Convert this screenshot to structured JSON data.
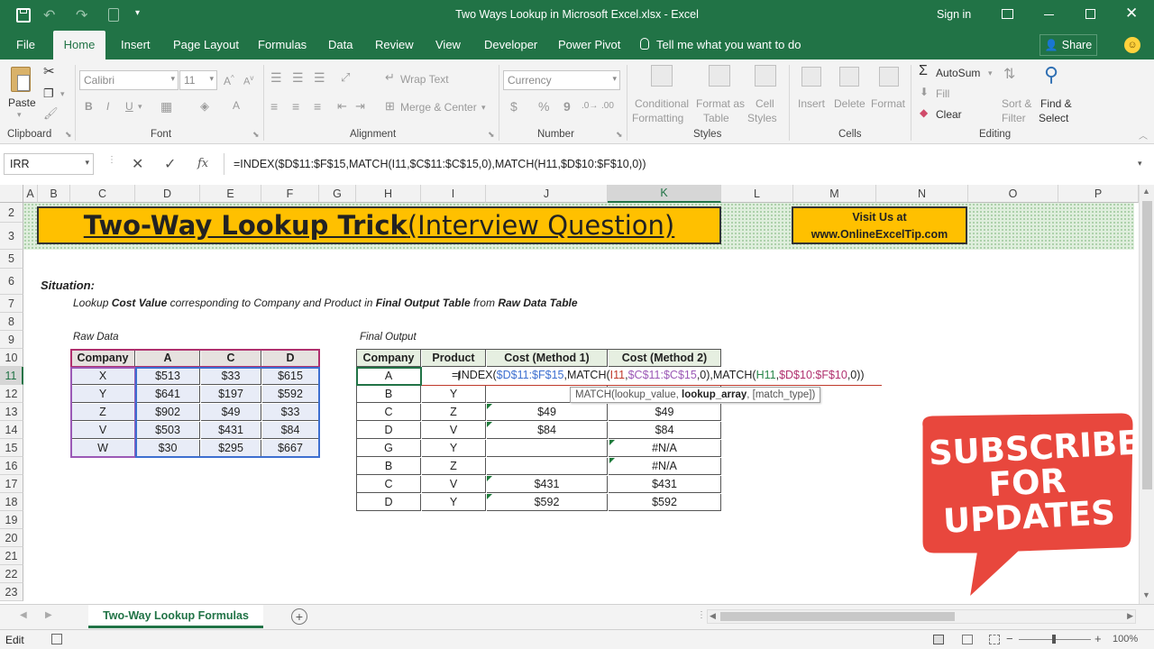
{
  "window": {
    "title": "Two Ways Lookup in Microsoft Excel.xlsx  -  Excel",
    "sign_in": "Sign in"
  },
  "tabs": [
    "File",
    "Home",
    "Insert",
    "Page Layout",
    "Formulas",
    "Data",
    "Review",
    "View",
    "Developer",
    "Power Pivot"
  ],
  "tell_me": "Tell me what you want to do",
  "share": "Share",
  "ribbon": {
    "clipboard": {
      "paste": "Paste",
      "label": "Clipboard"
    },
    "font": {
      "name": "Calibri",
      "size": "11",
      "label": "Font",
      "bold": "B",
      "italic": "I",
      "underline": "U"
    },
    "alignment": {
      "wrap": "Wrap Text",
      "merge": "Merge & Center",
      "label": "Alignment"
    },
    "number": {
      "format": "Currency",
      "currency": "$",
      "percent": "%",
      "comma": "9",
      "label": "Number"
    },
    "styles": {
      "conditional": "Conditional",
      "formatting": "Formatting",
      "format_as": "Format as",
      "table": "Table",
      "cell": "Cell",
      "cell_styles": "Styles",
      "label": "Styles"
    },
    "cells": {
      "insert": "Insert",
      "delete": "Delete",
      "format": "Format",
      "label": "Cells"
    },
    "editing": {
      "autosum": "AutoSum",
      "fill": "Fill",
      "clear": "Clear",
      "sort": "Sort &",
      "filter": "Filter",
      "find": "Find &",
      "select": "Select",
      "label": "Editing"
    }
  },
  "formula_bar": {
    "name_box": "IRR",
    "fx": "fx",
    "formula": "=INDEX($D$11:$F$15,MATCH(I11,$C$11:$C$15,0),MATCH(H11,$D$10:$F$10,0))"
  },
  "columns": [
    "A",
    "B",
    "C",
    "D",
    "E",
    "F",
    "G",
    "H",
    "I",
    "J",
    "K",
    "L",
    "M",
    "N",
    "O",
    "P"
  ],
  "rows": [
    "2",
    "3",
    "5",
    "6",
    "7",
    "8",
    "9",
    "10",
    "11",
    "12",
    "13",
    "14",
    "15",
    "16",
    "17",
    "18",
    "19",
    "20",
    "21",
    "22",
    "23"
  ],
  "sheet": {
    "title_bold": "Two-Way Lookup Trick",
    "title_rest": " (Interview Question)",
    "visit_line1": "Visit Us at",
    "visit_line2": "www.OnlineExcelTip.com",
    "situation": "Situation:",
    "desc": [
      "Lookup ",
      "Cost Value",
      " corresponding to Company and Product in ",
      "Final Output Table",
      " from ",
      "Raw Data Table"
    ],
    "raw_caption": "Raw Data",
    "out_caption": "Final Output",
    "raw_headers": [
      "Company",
      "A",
      "C",
      "D"
    ],
    "raw_rows": [
      [
        "X",
        "$513",
        "$33",
        "$615"
      ],
      [
        "Y",
        "$641",
        "$197",
        "$592"
      ],
      [
        "Z",
        "$902",
        "$49",
        "$33"
      ],
      [
        "V",
        "$503",
        "$431",
        "$84"
      ],
      [
        "W",
        "$30",
        "$295",
        "$667"
      ]
    ],
    "out_headers": [
      "Company",
      "Product",
      "Cost (Method 1)",
      "Cost (Method 2)"
    ],
    "out_rows": [
      [
        "A",
        "",
        "",
        ""
      ],
      [
        "B",
        "Y",
        "",
        ""
      ],
      [
        "C",
        "Z",
        "$49",
        "$49"
      ],
      [
        "D",
        "V",
        "$84",
        "$84"
      ],
      [
        "G",
        "Y",
        "",
        "#N/A"
      ],
      [
        "B",
        "Z",
        "",
        "#N/A"
      ],
      [
        "C",
        "V",
        "$431",
        "$431"
      ],
      [
        "D",
        "Y",
        "$592",
        "$592"
      ]
    ],
    "editing_formula": [
      "=INDEX(",
      "$D$11:$F$15",
      ",MATCH(",
      "I11",
      ",",
      "$C$11:$C$15",
      ",0),MATCH(",
      "H11",
      ",",
      "$D$10:$F$10",
      ",0))"
    ],
    "tooltip": [
      "MATCH(lookup_value, ",
      "lookup_array",
      ", [match_type])"
    ]
  },
  "subscribe": [
    "SUBSCRIBE",
    "FOR",
    "UPDATES"
  ],
  "sheet_tab": "Two-Way Lookup Formulas",
  "status": {
    "mode": "Edit",
    "zoom": "100%"
  },
  "colors": {
    "excel_green": "#217346",
    "title_fill": "#ffc000",
    "subscribe_red": "#e8473d"
  }
}
